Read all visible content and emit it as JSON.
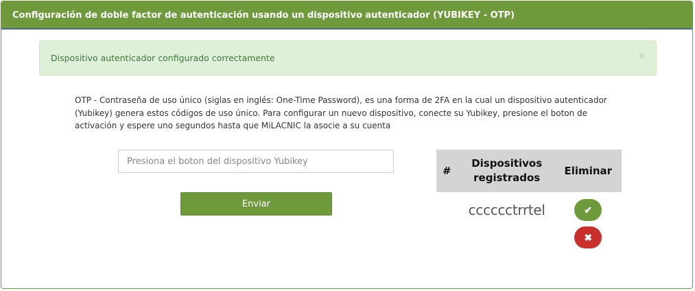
{
  "panel": {
    "title": "Configuración de doble factor de autenticación usando un dispositivo autenticador (YUBIKEY - OTP)"
  },
  "alert": {
    "message": "Dispositivo autenticador configurado correctamente",
    "close_glyph": "×"
  },
  "description": "OTP - Contraseña de uso único (siglas en inglés: One-Time Password), es una forma de 2FA en la cual un dispositivo autenticador (Yubikey) genera estos códigos de uso único. Para configurar un nuevo dispositivo, conecte su Yubikey, presione el boton de activación y espere uno segundos hasta que MiLACNIC la asocie a su cuenta",
  "form": {
    "otp_placeholder": "Presiona el boton del dispositivo Yubikey",
    "otp_value": "",
    "submit_label": "Enviar"
  },
  "devices_table": {
    "headers": [
      "#",
      "Dispositivos registrados",
      "Eliminar"
    ],
    "rows": [
      {
        "number": "",
        "device": "cccccctrrtel",
        "confirm_icon": "check-icon",
        "delete_icon": "times-icon"
      }
    ]
  },
  "colors": {
    "brand_green": "#6e9a3c",
    "alert_bg": "#dff0d8",
    "alert_text": "#3c763d",
    "danger_red": "#c9302c",
    "table_header_bg": "#d4d4d4"
  },
  "icons": {
    "check": "✔",
    "times": "✖"
  }
}
